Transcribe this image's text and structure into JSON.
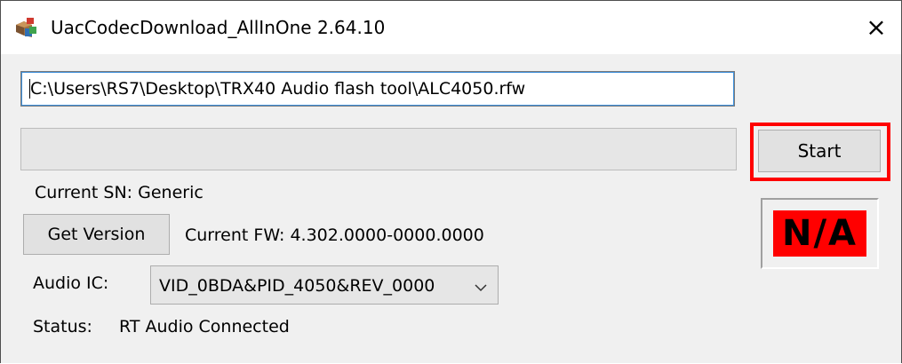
{
  "window": {
    "title": "UacCodecDownload_AllInOne 2.64.10",
    "icon": "app-icon",
    "close_glyph": "×"
  },
  "file_path": {
    "value": "C:\\Users\\RS7\\Desktop\\TRX40 Audio flash tool\\ALC4050.rfw"
  },
  "progress": {
    "fraction": 0
  },
  "start_button": {
    "label": "Start",
    "highlight_color": "#ff0000"
  },
  "info": {
    "current_sn": "Current SN: Generic",
    "get_version_label": "Get Version",
    "current_fw": "Current FW: 4.302.0000-0000.0000",
    "audio_ic_label": "Audio IC:",
    "audio_ic_value": "VID_0BDA&PID_4050&REV_0000",
    "status_label": "Status:",
    "status_value": "RT Audio Connected"
  },
  "result_indicator": {
    "text": "N/A",
    "background_color": "#ff0000"
  }
}
